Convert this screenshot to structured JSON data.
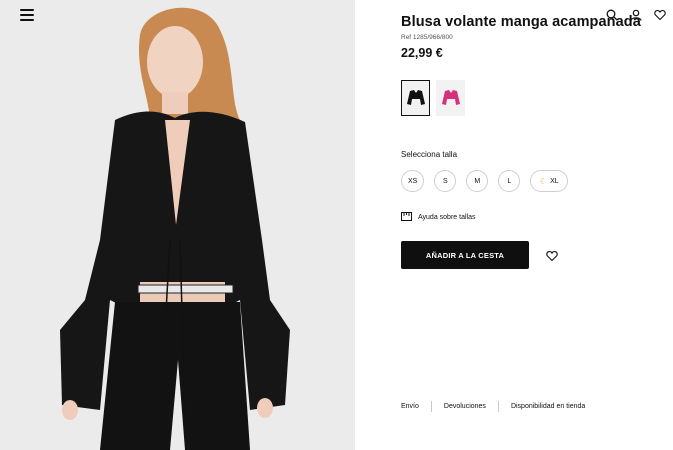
{
  "product": {
    "title": "Blusa volante manga acampanada",
    "ref": "Ref 1285/966/800",
    "price": "22,99 €"
  },
  "header": {
    "icons": [
      "menu-icon",
      "search-icon",
      "user-icon",
      "heart-icon"
    ]
  },
  "colors": {
    "swatches": [
      {
        "name": "black",
        "hex": "#111111",
        "selected": true
      },
      {
        "name": "pink",
        "hex": "#d6307a",
        "selected": false
      }
    ]
  },
  "sizes": {
    "label": "Selecciona talla",
    "options": [
      "XS",
      "S",
      "M",
      "L",
      "XL"
    ]
  },
  "help": {
    "label": "Ayuda sobre tallas"
  },
  "cart": {
    "add_label": "AÑADIR A LA CESTA"
  },
  "footer": {
    "links": [
      "Envío",
      "Devoluciones",
      "Disponibilidad en tienda"
    ]
  },
  "theme": {
    "button_bg": "#0f0f0f",
    "image_bg": "#ebebeb"
  }
}
